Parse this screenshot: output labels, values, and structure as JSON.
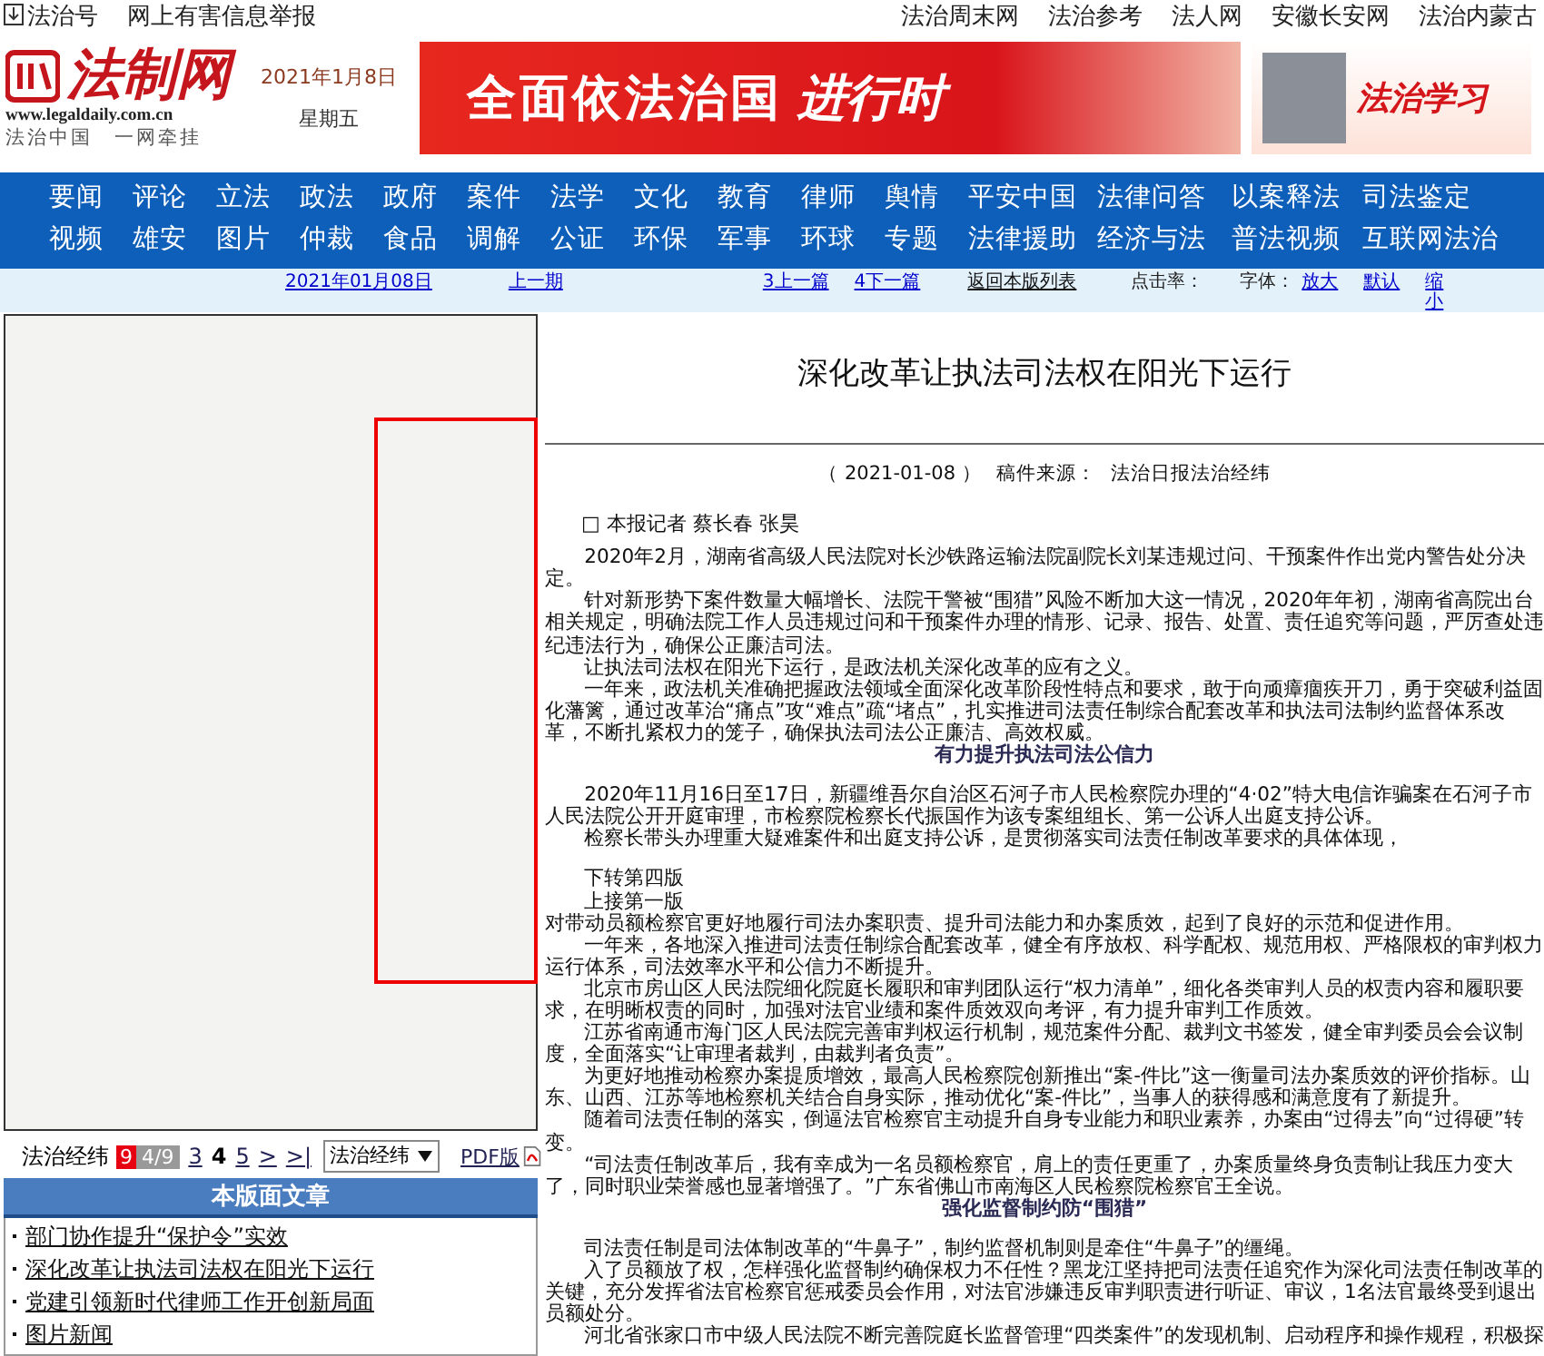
{
  "top_bar": {
    "left": [
      "法治号",
      "网上有害信息举报"
    ],
    "right": [
      "法治周末网",
      "法治参考",
      "法人网",
      "安徽长安网",
      "法治内蒙古"
    ]
  },
  "header": {
    "logo": "法制网",
    "url": "www.legaldaily.com.cn",
    "slogan": "法治中国　一网牵挂",
    "date": "2021年1月8日",
    "weekday": "星期五",
    "banner_main": "全面依法治国",
    "banner_accent": "进行时",
    "banner_side": "法治学习"
  },
  "nav_rows": [
    [
      "要闻",
      "评论",
      "立法",
      "政法",
      "政府",
      "案件",
      "法学",
      "文化",
      "教育",
      "律师",
      "舆情",
      "平安中国",
      "法律问答",
      "以案释法",
      "司法鉴定"
    ],
    [
      "视频",
      "雄安",
      "图片",
      "仲裁",
      "食品",
      "调解",
      "公证",
      "环保",
      "军事",
      "环球",
      "专题",
      "法律援助",
      "经济与法",
      "普法视频",
      "互联网法治"
    ]
  ],
  "issue_bar": {
    "date": "2021年01月08日",
    "prev_issue": "上一期",
    "prev_article": "3上一篇",
    "next_article": "4下一篇",
    "back": "返回本版列表",
    "hits_label": "点击率：",
    "font_label": "字体：",
    "font_links": [
      "放大",
      "默认",
      "缩小"
    ]
  },
  "page_nav": {
    "section": "法治经纬",
    "total": "9",
    "current": "4/9",
    "pages": [
      {
        "label": "3",
        "selected": false
      },
      {
        "label": "4",
        "selected": true
      },
      {
        "label": "5",
        "selected": false
      },
      {
        "label": ">",
        "selected": false
      },
      {
        "label": ">|",
        "selected": false
      }
    ],
    "select": "法治经纬",
    "pdf": "PDF版"
  },
  "page_articles": {
    "title": "本版面文章",
    "items": [
      "部门协作提升“保护令”实效",
      "深化改革让执法司法权在阳光下运行",
      "党建引领新时代律师工作开创新局面",
      "图片新闻"
    ]
  },
  "article": {
    "title": "深化改革让执法司法权在阳光下运行",
    "date": "（ 2021-01-08 ）",
    "source_label": "稿件来源：",
    "source": "法治日报法治经纬",
    "byline": "□ 本报记者 蔡长春 张昊",
    "blocks": [
      {
        "kind": "para",
        "text": "2020年2月，湖南省高级人民法院对长沙铁路运输法院副院长刘某违规过问、干预案件作出党内警告处分决定。"
      },
      {
        "kind": "para",
        "text": "针对新形势下案件数量大幅增长、法院干警被“围猎”风险不断加大这一情况，2020年年初，湖南省高院出台相关规定，明确法院工作人员违规过问和干预案件办理的情形、记录、报告、处置、责任追究等问题，严厉查处违纪违法行为，确保公正廉洁司法。"
      },
      {
        "kind": "para",
        "text": "让执法司法权在阳光下运行，是政法机关深化改革的应有之义。"
      },
      {
        "kind": "para",
        "text": "一年来，政法机关准确把握政法领域全面深化改革阶段性特点和要求，敢于向顽瘴痼疾开刀，勇于突破利益固化藩篱，通过改革治“痛点”攻“难点”疏“堵点”，扎实推进司法责任制综合配套改革和执法司法制约监督体系改革，不断扎紧权力的笼子，确保执法司法公正廉洁、高效权威。"
      },
      {
        "kind": "heading",
        "text": "有力提升执法司法公信力"
      },
      {
        "kind": "para",
        "text": "2020年11月16日至17日，新疆维吾尔自治区石河子市人民检察院办理的“4·02”特大电信诈骗案在石河子市人民法院公开开庭审理，市检察院检察长代振国作为该专案组组长、第一公诉人出庭支持公诉。"
      },
      {
        "kind": "para",
        "text": "检察长带头办理重大疑难案件和出庭支持公诉，是贯彻落实司法责任制改革要求的具体体现，"
      },
      {
        "kind": "ref",
        "text": "下转第四版"
      },
      {
        "kind": "para",
        "text": "上接第一版"
      },
      {
        "kind": "cont",
        "text": "对带动员额检察官更好地履行司法办案职责、提升司法能力和办案质效，起到了良好的示范和促进作用。"
      },
      {
        "kind": "para",
        "text": "一年来，各地深入推进司法责任制综合配套改革，健全有序放权、科学配权、规范用权、严格限权的审判权力运行体系，司法效率水平和公信力不断提升。"
      },
      {
        "kind": "para",
        "text": "北京市房山区人民法院细化院庭长履职和审判团队运行“权力清单”，细化各类审判人员的权责内容和履职要求，在明晰权责的同时，加强对法官业绩和案件质效双向考评，有力提升审判工作质效。"
      },
      {
        "kind": "para",
        "text": "江苏省南通市海门区人民法院完善审判权运行机制，规范案件分配、裁判文书签发，健全审判委员会会议制度，全面落实“让审理者裁判，由裁判者负责”。"
      },
      {
        "kind": "para",
        "text": "为更好地推动检察办案提质增效，最高人民检察院创新推出“案-件比”这一衡量司法办案质效的评价指标。山东、山西、江苏等地检察机关结合自身实际，推动优化“案-件比”，当事人的获得感和满意度有了新提升。"
      },
      {
        "kind": "para",
        "text": "随着司法责任制的落实，倒逼法官检察官主动提升自身专业能力和职业素养，办案由“过得去”向“过得硬”转变。"
      },
      {
        "kind": "para",
        "text": "“司法责任制改革后，我有幸成为一名员额检察官，肩上的责任更重了，办案质量终身负责制让我压力变大了，同时职业荣誉感也显著增强了。”广东省佛山市南海区人民检察院检察官王全说。"
      },
      {
        "kind": "heading",
        "text": "强化监督制约防“围猎”"
      },
      {
        "kind": "para",
        "text": "司法责任制是司法体制改革的“牛鼻子”，制约监督机制则是牵住“牛鼻子”的缰绳。"
      },
      {
        "kind": "para",
        "text": "入了员额放了权，怎样强化监督制约确保权力不任性？黑龙江坚持把司法责任追究作为深化司法责任制改革的关键，充分发挥省法官检察官惩戒委员会作用，对法官涉嫌违反审判职责进行听证、审议，1名法官最终受到退出员额处分。"
      },
      {
        "kind": "para",
        "text": "河北省张家口市中级人民法院不断完善院庭长监督管理“四类案件”的发现机制、启动程序和操作规程，积极探"
      }
    ]
  }
}
